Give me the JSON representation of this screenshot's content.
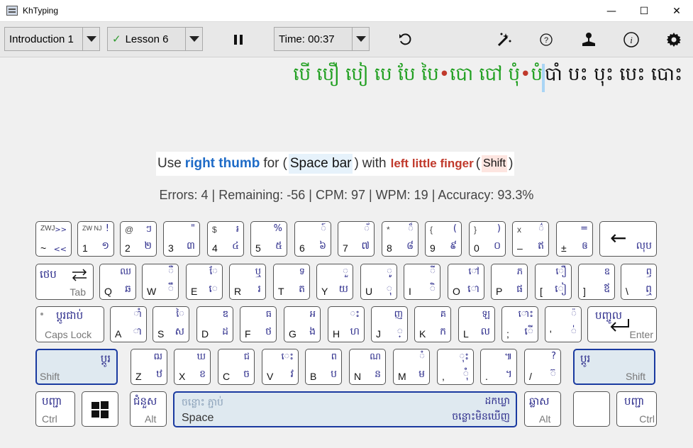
{
  "window": {
    "title": "KhTyping",
    "minimize": "—",
    "maximize": "☐",
    "close": "✕"
  },
  "toolbar": {
    "level": "Introduction 1",
    "lesson": "Lesson 6",
    "lesson_check": "✓",
    "timer": "Time: 00:37",
    "pause_icon": "pause-icon",
    "restart_icon": "restart-icon",
    "help": "?",
    "info": "i"
  },
  "lesson": {
    "typed": "បើ បឿ បៀ បេ បែ បៃ•បោ បៅ បុំ•បំ",
    "upcoming": "បាំ បះ បុះ បេះ បោះ"
  },
  "hint": {
    "use": "Use",
    "right_thumb": "right thumb",
    "for": "for",
    "space_bar": "Space bar",
    "with": "with",
    "left_little": "left little finger",
    "shift": "Shift",
    "paren_open": "(",
    "paren_close": ")"
  },
  "stats": "Errors: 4 | Remaining: -56 | CPM: 97 | WPM: 19 | Accuracy: 93.3%",
  "keyboard": {
    "row1": [
      {
        "se": "ZWJ",
        "sk": ">>",
        "en": "~",
        "kh": "<<"
      },
      {
        "se": "ZW NJ",
        "sk": "!",
        "en": "1",
        "kh": "១"
      },
      {
        "se": "@",
        "sk": "ៗ",
        "en": "2",
        "kh": "២"
      },
      {
        "se": "",
        "sk": "\"",
        "en": "3",
        "kh": "៣"
      },
      {
        "se": "$",
        "sk": "៛",
        "en": "4",
        "kh": "៤"
      },
      {
        "se": "",
        "sk": "%",
        "en": "5",
        "kh": "៥"
      },
      {
        "se": "",
        "sk": "៍",
        "en": "6",
        "kh": "៦"
      },
      {
        "se": "",
        "sk": "័",
        "en": "7",
        "kh": "៧"
      },
      {
        "se": "*",
        "sk": "៏",
        "en": "8",
        "kh": "៨"
      },
      {
        "se": "{",
        "sk": "(",
        "en": "9",
        "kh": "៩"
      },
      {
        "se": "}",
        "sk": ")",
        "en": "0",
        "kh": "០"
      },
      {
        "se": "x",
        "sk": "៌",
        "en": "–",
        "kh": "ឥ"
      },
      {
        "se": "",
        "sk": "=",
        "en": "±",
        "kh": "ឲ"
      }
    ],
    "backspace": {
      "kh": "លុប",
      "arrow": "←"
    },
    "row2": [
      {
        "en": "Q",
        "kh": "ឆ",
        "sk": "ឈ"
      },
      {
        "en": "W",
        "kh": "ឹ",
        "sk": "ឺ"
      },
      {
        "en": "E",
        "kh": "េ",
        "sk": "ែ"
      },
      {
        "en": "R",
        "kh": "រ",
        "sk": "ឬ"
      },
      {
        "en": "T",
        "kh": "ត",
        "sk": "ទ"
      },
      {
        "en": "Y",
        "kh": "យ",
        "sk": "ួ"
      },
      {
        "en": "U",
        "kh": "ុ",
        "sk": "ូ"
      },
      {
        "en": "I",
        "kh": "ិ",
        "sk": "ី"
      },
      {
        "en": "O",
        "kh": "ោ",
        "sk": "ៅ"
      },
      {
        "en": "P",
        "kh": "ផ",
        "sk": "ភ"
      },
      {
        "en": "[",
        "kh": "ៀ",
        "sk": "ឿ"
      },
      {
        "en": "]",
        "kh": "ឪ",
        "sk": "ឧ"
      },
      {
        "en": "\\",
        "kh": "ឮ",
        "sk": "ឭ"
      }
    ],
    "tab": {
      "kh": "ថេប",
      "en": "Tab"
    },
    "row3": [
      {
        "en": "A",
        "kh": "ា",
        "sk": "ាំ"
      },
      {
        "en": "S",
        "kh": "ស",
        "sk": "ៃ"
      },
      {
        "en": "D",
        "kh": "ដ",
        "sk": "ឌ"
      },
      {
        "en": "F",
        "kh": "ថ",
        "sk": "ធ"
      },
      {
        "en": "G",
        "kh": "ង",
        "sk": "អ"
      },
      {
        "en": "H",
        "kh": "ហ",
        "sk": "ះ"
      },
      {
        "en": "J",
        "kh": "្",
        "sk": "ញ"
      },
      {
        "en": "K",
        "kh": "ក",
        "sk": "គ"
      },
      {
        "en": "L",
        "kh": "ល",
        "sk": "ឡ"
      },
      {
        "en": ";",
        "kh": "ើ",
        "sk": "ោះ"
      },
      {
        "en": "'",
        "kh": "់",
        "sk": "៉"
      }
    ],
    "caps": {
      "kh": "ប្តូរជាប់",
      "en": "Caps Lock"
    },
    "enter": {
      "kh": "បញ្ចូល",
      "en": "Enter"
    },
    "row4": [
      {
        "en": "Z",
        "kh": "ឋ",
        "sk": "ឍ"
      },
      {
        "en": "X",
        "kh": "ខ",
        "sk": "ឃ"
      },
      {
        "en": "C",
        "kh": "ច",
        "sk": "ជ"
      },
      {
        "en": "V",
        "kh": "វ",
        "sk": "េះ"
      },
      {
        "en": "B",
        "kh": "ប",
        "sk": "ព"
      },
      {
        "en": "N",
        "kh": "ន",
        "sk": "ណ"
      },
      {
        "en": "M",
        "kh": "ម",
        "sk": "ំ"
      },
      {
        "en": ",",
        "kh": "ុំ",
        "sk": "ុះ"
      },
      {
        "en": ".",
        "kh": "។",
        "sk": "៕"
      },
      {
        "en": "/",
        "kh": "៊",
        "sk": "?"
      }
    ],
    "lshift": {
      "kh": "ប្តូរ",
      "en": "Shift"
    },
    "rshift": {
      "kh": "ប្តូរ",
      "en": "Shift"
    },
    "lctrl": {
      "kh": "បញ្ជា",
      "en": "Ctrl"
    },
    "lalt": {
      "kh": "ជំនួស",
      "en": "Alt"
    },
    "space": {
      "kh_top_left": "ចន្លោះ ភ្ជាប់",
      "kh_top_right": "ដកឃ្លា",
      "en": "Space",
      "kh_bottom": "ចន្លោះមិនឃើញ"
    },
    "ralt": {
      "kh": "ឆ្លាស",
      "en": "Alt"
    },
    "rctrl": {
      "kh": "បញ្ជា",
      "en": "Ctrl"
    }
  },
  "colors": {
    "typed": "#22a022",
    "error": "#c0392b",
    "highlight": "#1a3aa0",
    "hint_blue": "#1e6bc7"
  }
}
